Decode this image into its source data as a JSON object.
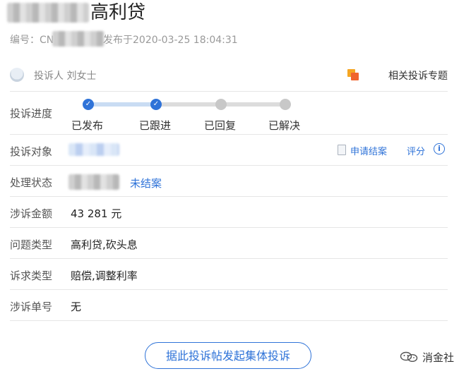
{
  "complaint": {
    "title": "高利贷",
    "id_prefix": "编号：CN",
    "published_suffix": "发布于2020-03-25 18:04:31",
    "complainant_label": "投诉人 刘女士",
    "related_topic_label": "相关投诉专题"
  },
  "progress": {
    "label": "投诉进度",
    "steps": [
      {
        "label": "已发布",
        "done": true
      },
      {
        "label": "已跟进",
        "done": true
      },
      {
        "label": "已回复",
        "done": false
      },
      {
        "label": "已解决",
        "done": false
      }
    ]
  },
  "target": {
    "label": "投诉对象",
    "apply_close_label": "申请结案",
    "rate_label": "评分",
    "info_glyph": "i"
  },
  "status": {
    "label": "处理状态",
    "value": "未结案"
  },
  "details": [
    {
      "label": "涉诉金额",
      "value": "43 281 元"
    },
    {
      "label": "问题类型",
      "value": "高利贷,砍头息"
    },
    {
      "label": "诉求类型",
      "value": "赔偿,调整利率"
    },
    {
      "label": "涉诉单号",
      "value": "无"
    }
  ],
  "actions": {
    "group_complaint_label": "据此投诉帖发起集体投诉"
  },
  "watermark": {
    "text": "消金社"
  },
  "colors": {
    "accent": "#2f73d8",
    "done_track": "#c9dcf3",
    "todo_track": "#dcdcdc"
  },
  "icons": {
    "check": "✓"
  }
}
